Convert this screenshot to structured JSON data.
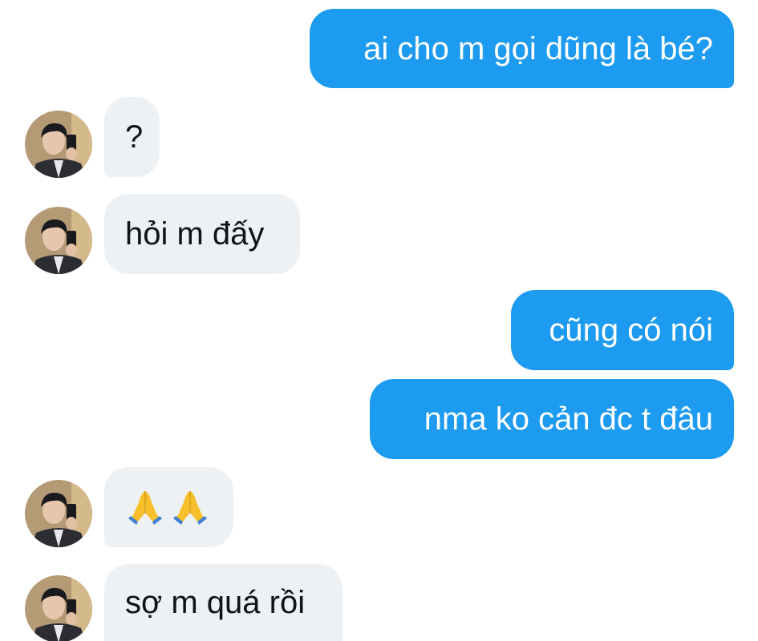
{
  "colors": {
    "outgoing_bubble": "#1d9bf0",
    "outgoing_text": "#ffffff",
    "incoming_bubble": "#eef1f4",
    "incoming_text": "#0f1419"
  },
  "messages": [
    {
      "direction": "outgoing",
      "text": "ai cho m gọi dũng là bé?"
    },
    {
      "direction": "incoming",
      "text": "?"
    },
    {
      "direction": "incoming",
      "text": "hỏi m đấy"
    },
    {
      "direction": "outgoing",
      "text": "cũng có nói"
    },
    {
      "direction": "outgoing",
      "text": "nma ko cản đc t đâu"
    },
    {
      "direction": "incoming",
      "emoji": [
        "folded-hands-icon",
        "folded-hands-icon"
      ]
    },
    {
      "direction": "incoming",
      "text": "sợ m quá rồi"
    }
  ]
}
